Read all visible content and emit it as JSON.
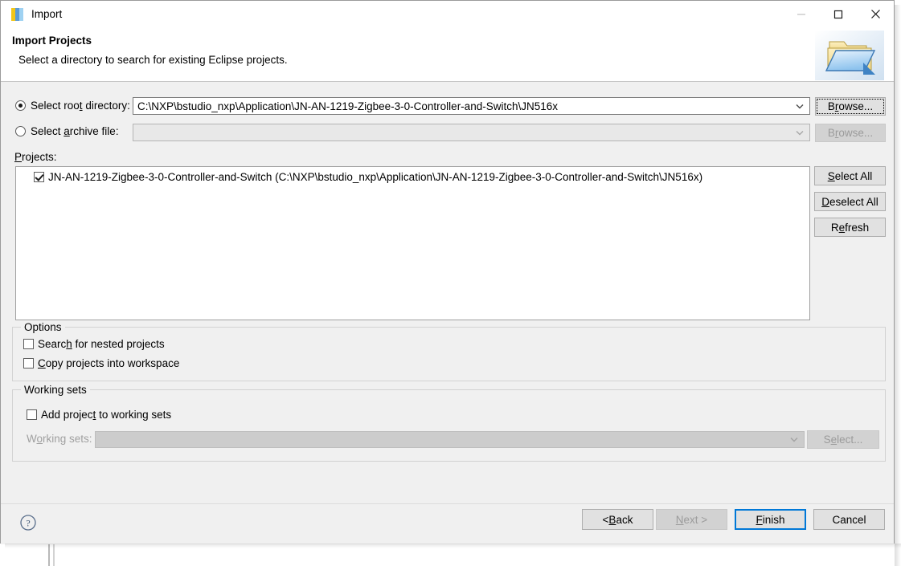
{
  "window": {
    "title": "Import",
    "icon": "import-icon",
    "controls": {
      "minimize": "minimize-icon",
      "maximize": "maximize-icon",
      "close": "close-icon"
    }
  },
  "header": {
    "title": "Import Projects",
    "subtitle": "Select a directory to search for existing Eclipse projects.",
    "icon": "open-folder-icon"
  },
  "source": {
    "root_directory": {
      "label_pre": "Select roo",
      "label_mnemonic": "t",
      "label_post": " directory:",
      "selected": true,
      "value": "C:\\NXP\\bstudio_nxp\\Application\\JN-AN-1219-Zigbee-3-0-Controller-and-Switch\\JN516x",
      "browse_pre": "B",
      "browse_mnemonic": "r",
      "browse_post": "owse...",
      "browse_enabled": true
    },
    "archive_file": {
      "label_pre": "Select ",
      "label_mnemonic": "a",
      "label_post": "rchive file:",
      "selected": false,
      "value": "",
      "browse_pre": "B",
      "browse_mnemonic": "r",
      "browse_post": "owse...",
      "browse_enabled": false
    }
  },
  "projects": {
    "label_mnemonic": "P",
    "label_post": "rojects:",
    "items": [
      {
        "checked": true,
        "label": "JN-AN-1219-Zigbee-3-0-Controller-and-Switch (C:\\NXP\\bstudio_nxp\\Application\\JN-AN-1219-Zigbee-3-0-Controller-and-Switch\\JN516x)"
      }
    ],
    "buttons": [
      {
        "pre": "",
        "mnemonic": "S",
        "post": "elect All",
        "enabled": true
      },
      {
        "pre": "",
        "mnemonic": "D",
        "post": "eselect All",
        "enabled": true
      },
      {
        "pre": "R",
        "mnemonic": "e",
        "post": "fresh",
        "enabled": true
      }
    ]
  },
  "options": {
    "title": "Options",
    "items": [
      {
        "checked": false,
        "pre": "Searc",
        "mnemonic": "h",
        "post": " for nested projects"
      },
      {
        "checked": false,
        "pre": "",
        "mnemonic": "C",
        "post": "opy projects into workspace"
      }
    ]
  },
  "working_sets": {
    "title": "Working sets",
    "add_checkbox": {
      "checked": false,
      "pre": "Add projec",
      "mnemonic": "t",
      "post": " to working sets"
    },
    "combo_label_pre": "W",
    "combo_label_mnemonic": "o",
    "combo_label_post": "rking sets:",
    "combo_value": "",
    "combo_enabled": false,
    "select_button": {
      "pre": "S",
      "mnemonic": "e",
      "post": "lect...",
      "enabled": false
    }
  },
  "footer": {
    "help_icon": "help-icon",
    "buttons": [
      {
        "pre": "< ",
        "mnemonic": "B",
        "post": "ack",
        "enabled": true,
        "default": false
      },
      {
        "pre": "",
        "mnemonic": "N",
        "post": "ext >",
        "enabled": false,
        "default": false
      },
      {
        "pre": "",
        "mnemonic": "F",
        "post": "inish",
        "enabled": true,
        "default": true
      },
      {
        "pre": "Cancel",
        "mnemonic": "",
        "post": "",
        "enabled": true,
        "default": false
      }
    ]
  },
  "colors": {
    "dialog_bg": "#f0f0f0",
    "header_bg": "#ffffff",
    "accent": "#0078d7",
    "button_bg": "#e1e1e1"
  }
}
